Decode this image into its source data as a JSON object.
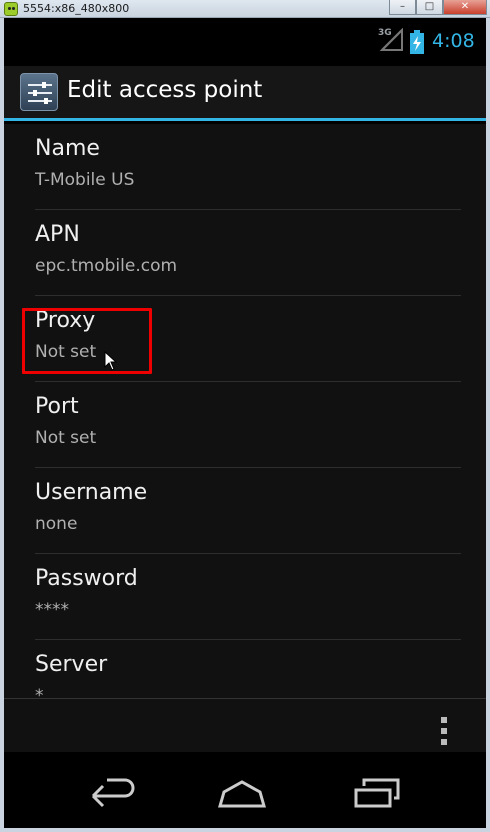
{
  "window": {
    "title": "5554:x86_480x800",
    "minimize_label": "–",
    "maximize_label": "□",
    "close_label": "✕"
  },
  "status_bar": {
    "network": "3G",
    "time": "4:08"
  },
  "action_bar": {
    "title": "Edit access point"
  },
  "preferences": [
    {
      "title": "Name",
      "summary": "T-Mobile US"
    },
    {
      "title": "APN",
      "summary": "epc.tmobile.com"
    },
    {
      "title": "Proxy",
      "summary": "Not set"
    },
    {
      "title": "Port",
      "summary": "Not set"
    },
    {
      "title": "Username",
      "summary": "none"
    },
    {
      "title": "Password",
      "summary": "****"
    },
    {
      "title": "Server",
      "summary": "*"
    }
  ],
  "colors": {
    "accent": "#33b5e5",
    "highlight": "#e00000"
  },
  "icons": {
    "app": "android-emulator-icon",
    "settings": "settings-sliders-icon",
    "overflow": "overflow-menu-icon",
    "back": "back-icon",
    "home": "home-icon",
    "recents": "recents-icon"
  }
}
